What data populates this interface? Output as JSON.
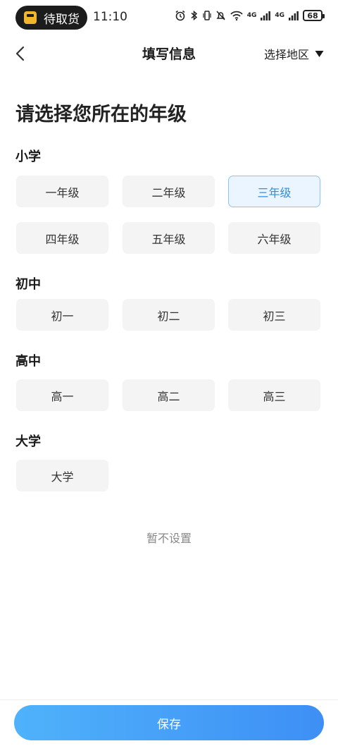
{
  "status_bar": {
    "pickup_label": "待取货",
    "time": "11:10",
    "signal_label_1": "4G",
    "signal_label_2": "4G",
    "battery": "68"
  },
  "header": {
    "title": "填写信息",
    "region_label": "选择地区"
  },
  "heading": "请选择您所在的年级",
  "sections": [
    {
      "title": "小学",
      "items": [
        "一年级",
        "二年级",
        "三年级",
        "四年级",
        "五年级",
        "六年级"
      ]
    },
    {
      "title": "初中",
      "items": [
        "初一",
        "初二",
        "初三"
      ]
    },
    {
      "title": "高中",
      "items": [
        "高一",
        "高二",
        "高三"
      ]
    },
    {
      "title": "大学",
      "items": [
        "大学"
      ]
    }
  ],
  "selected_grade": "三年级",
  "skip_label": "暂不设置",
  "save_label": "保存",
  "colors": {
    "accent": "#2f8ee0",
    "save_gradient_start": "#4fb2fb",
    "save_gradient_end": "#3e8ff5"
  }
}
